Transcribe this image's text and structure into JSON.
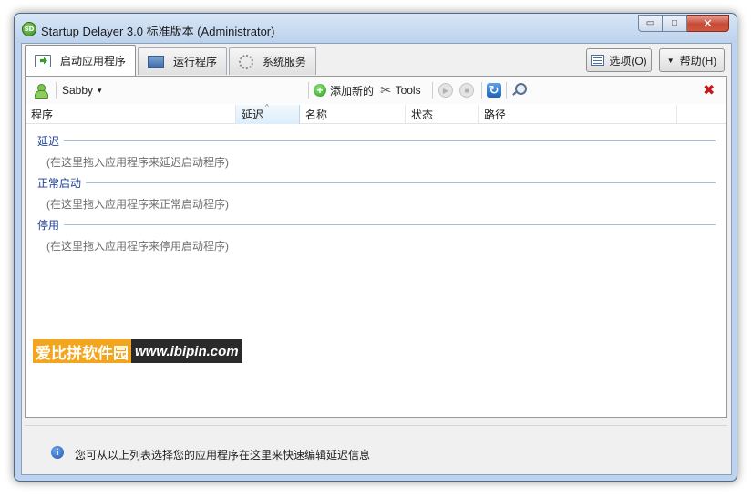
{
  "window": {
    "title": "Startup Delayer 3.0 标准版本 (Administrator)",
    "app_icon": "SD",
    "minimize_glyph": "▭",
    "maximize_glyph": "□",
    "close_glyph": "✕"
  },
  "tabs": [
    {
      "label": "启动应用程序",
      "icon": "startup-icon",
      "active": true
    },
    {
      "label": "运行程序",
      "icon": "running-programs-icon",
      "active": false
    },
    {
      "label": "系统服务",
      "icon": "services-gear-icon",
      "active": false
    }
  ],
  "top_buttons": {
    "options_label": "选项(O)",
    "help_label": "帮助(H)",
    "help_caret": "▼"
  },
  "toolbar": {
    "profile_name": "Sabby",
    "profile_caret": "▾",
    "add_label": "添加新的",
    "tools_label": "Tools",
    "play_glyph": "▶",
    "stop_glyph": "■",
    "refresh_glyph": "↻",
    "delete_glyph": "✖"
  },
  "columns": [
    {
      "label": "程序"
    },
    {
      "label": "延迟",
      "sorted": true,
      "sort_glyph": "^"
    },
    {
      "label": "名称"
    },
    {
      "label": "状态"
    },
    {
      "label": "路径"
    }
  ],
  "groups": [
    {
      "title": "延迟",
      "hint": "(在这里拖入应用程序来延迟启动程序)"
    },
    {
      "title": "正常启动",
      "hint": "(在这里拖入应用程序来正常启动程序)"
    },
    {
      "title": "停用",
      "hint": "(在这里拖入应用程序来停用启动程序)"
    }
  ],
  "watermark": {
    "cn": "爱比拼软件园",
    "url": "www.ibipin.com"
  },
  "info": {
    "icon_glyph": "i",
    "text": "您可从以上列表选择您的应用程序在这里来快速编辑延迟信息"
  },
  "colors": {
    "group_title": "#1e3f92",
    "hint_text": "#6d6d6d",
    "delete_red": "#c4161c",
    "watermark_orange": "#f3a51d"
  }
}
